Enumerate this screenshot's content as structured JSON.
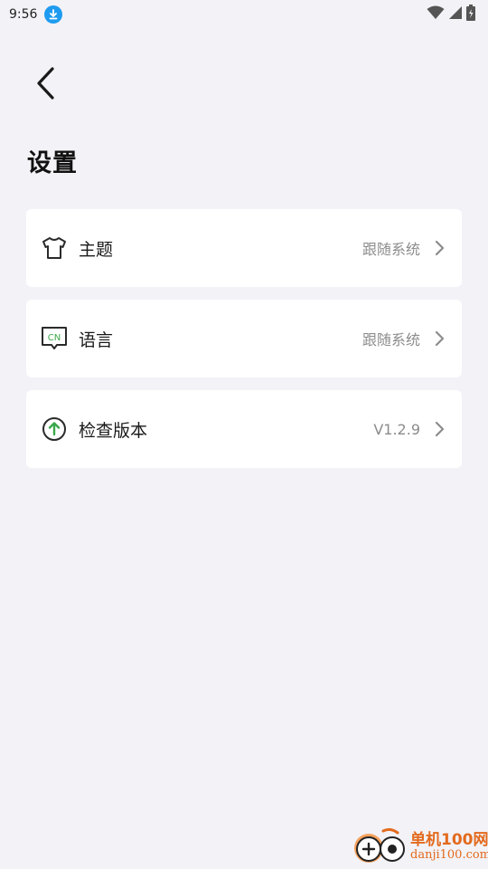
{
  "status_bar": {
    "time": "9:56",
    "icons": [
      "download-icon",
      "wifi-icon",
      "signal-icon",
      "battery-icon"
    ]
  },
  "header": {
    "back_icon": "back-arrow-icon",
    "title": "设置"
  },
  "settings": [
    {
      "icon": "tshirt-icon",
      "label": "主题",
      "value": "跟随系统"
    },
    {
      "icon": "language-cn-icon",
      "label": "语言",
      "value": "跟随系统",
      "icon_text": "CN"
    },
    {
      "icon": "upload-arrow-icon",
      "label": "检查版本",
      "value": "V1.2.9"
    }
  ],
  "watermark": {
    "name": "单机100网",
    "url": "danji100.com"
  },
  "colors": {
    "background": "#f2f2f7",
    "card": "#ffffff",
    "accent_green": "#3aa84a",
    "muted_text": "#8c8c8c",
    "download_badge": "#1e9bf0",
    "watermark": "#e36a1d"
  }
}
